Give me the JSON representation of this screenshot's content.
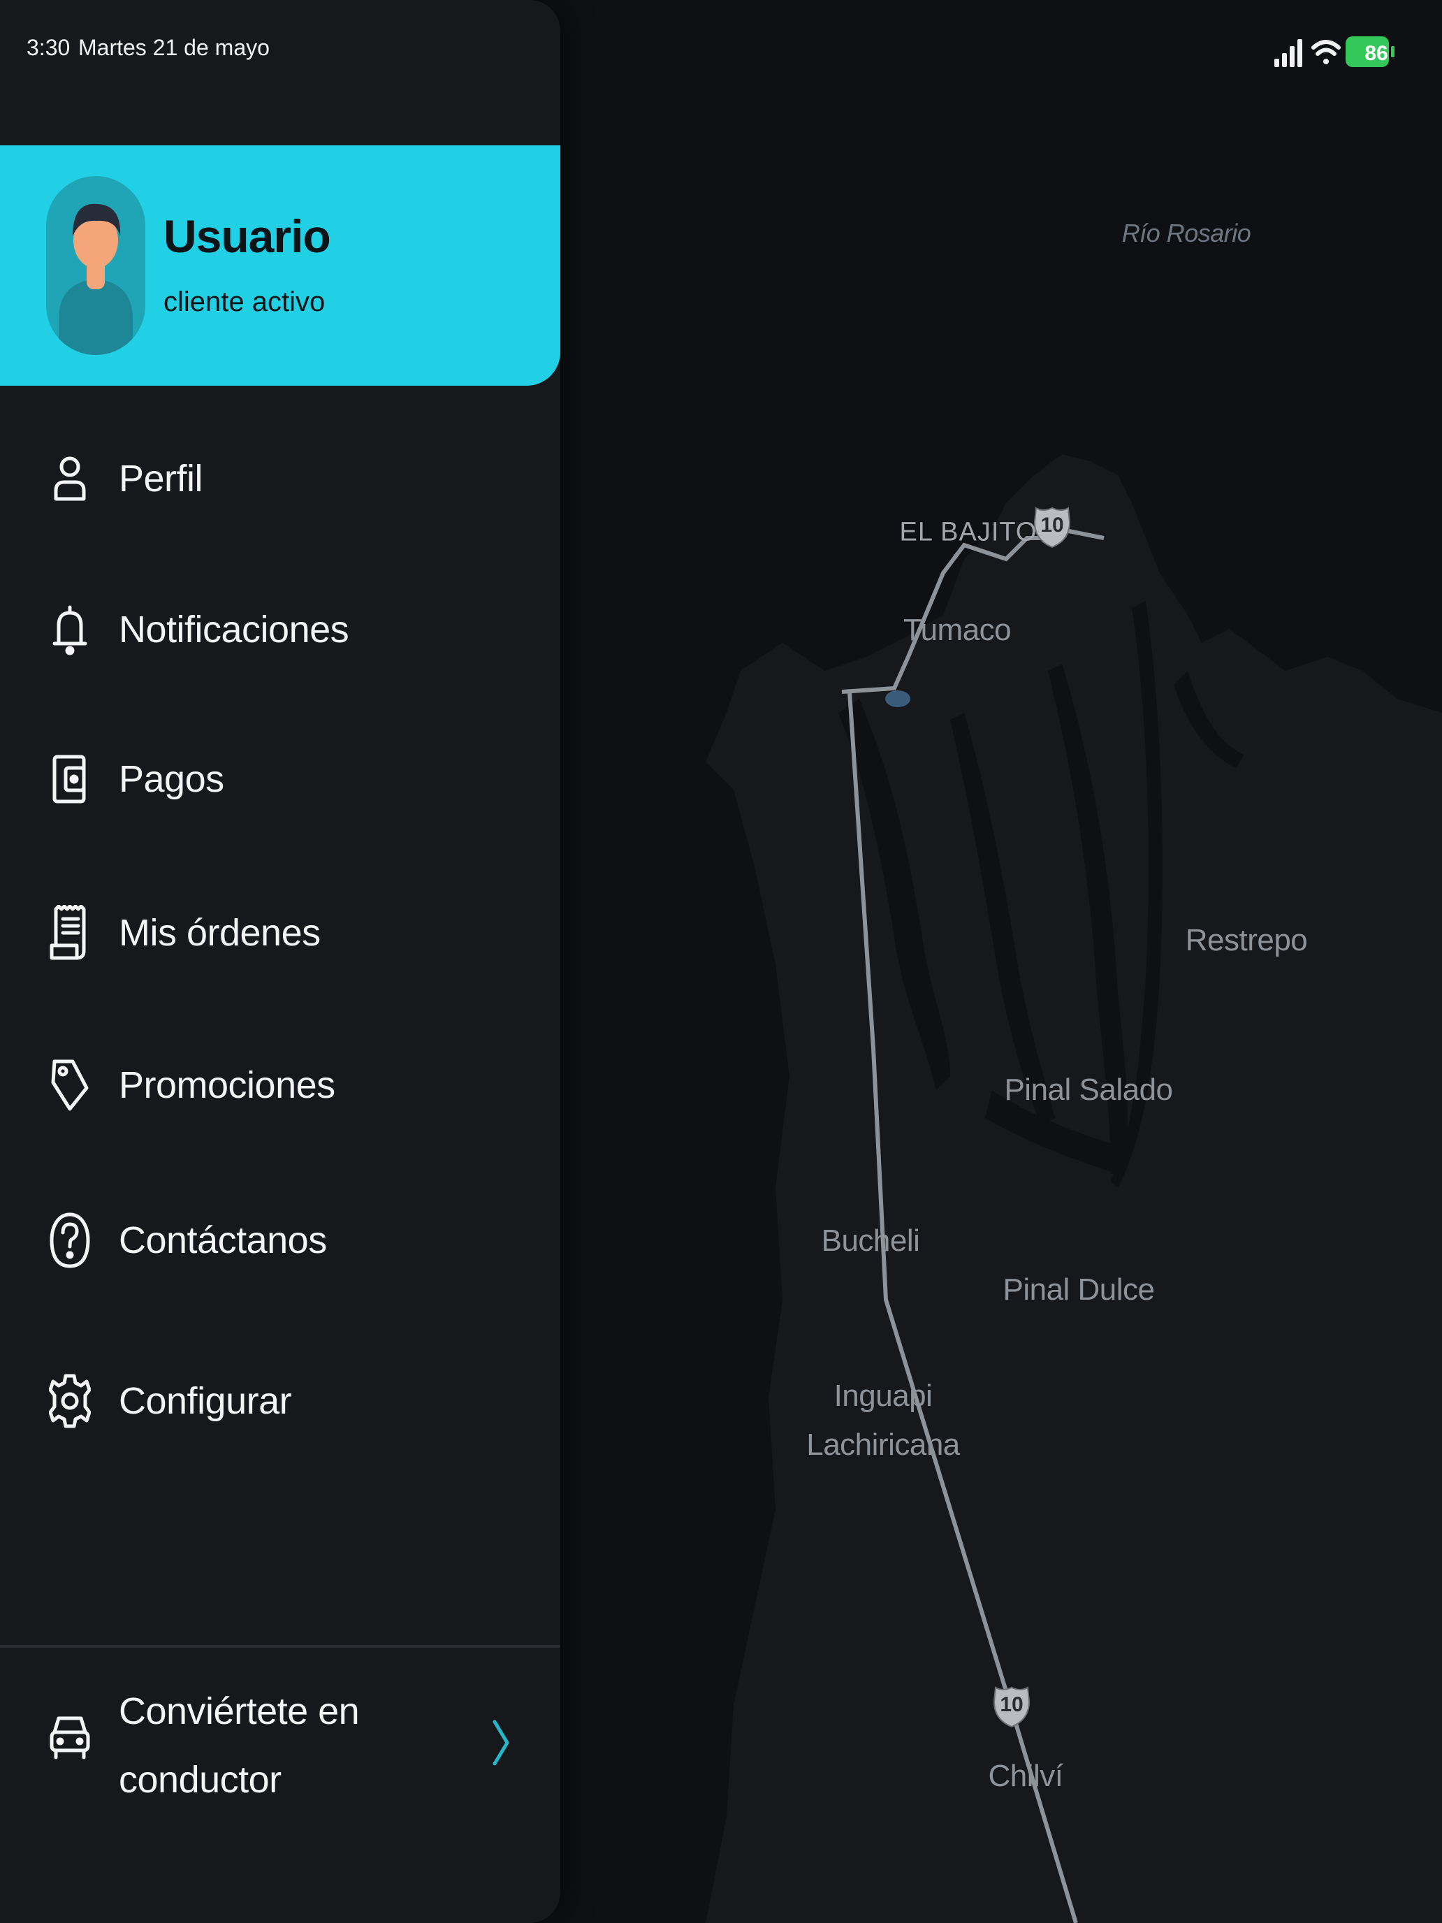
{
  "status_bar": {
    "time": "3:30",
    "date": "Martes 21 de mayo",
    "battery": "86"
  },
  "user": {
    "name": "Usuario",
    "status": "cliente activo"
  },
  "menu": {
    "items": [
      {
        "label": "Perfil",
        "icon": "person-icon"
      },
      {
        "label": "Notificaciones",
        "icon": "bell-icon"
      },
      {
        "label": "Pagos",
        "icon": "wallet-icon"
      },
      {
        "label": "Mis órdenes",
        "icon": "receipt-icon"
      },
      {
        "label": "Promociones",
        "icon": "tag-icon"
      },
      {
        "label": "Contáctanos",
        "icon": "help-icon"
      },
      {
        "label": "Configurar",
        "icon": "gear-icon"
      }
    ]
  },
  "driver_cta": {
    "line1": "Conviértete en",
    "line2": "conductor",
    "icon": "car-icon"
  },
  "map": {
    "labels": {
      "rio_rosario": "Río Rosario",
      "el_bajito": "EL BAJITO",
      "tumaco": "Tumaco",
      "restrepo": "Restrepo",
      "pinal_salado": "Pinal Salado",
      "bucheli": "Bucheli",
      "pinal_dulce": "Pinal Dulce",
      "inguapi": "Inguapi",
      "lachiricana": "Lachiricana",
      "chilvi": "Chilví"
    },
    "route_shields": [
      "10",
      "10"
    ]
  },
  "colors": {
    "accent": "#22d0e6",
    "drawer_bg": "#16181b",
    "map_bg": "#0e1013",
    "battery": "#34c759"
  }
}
